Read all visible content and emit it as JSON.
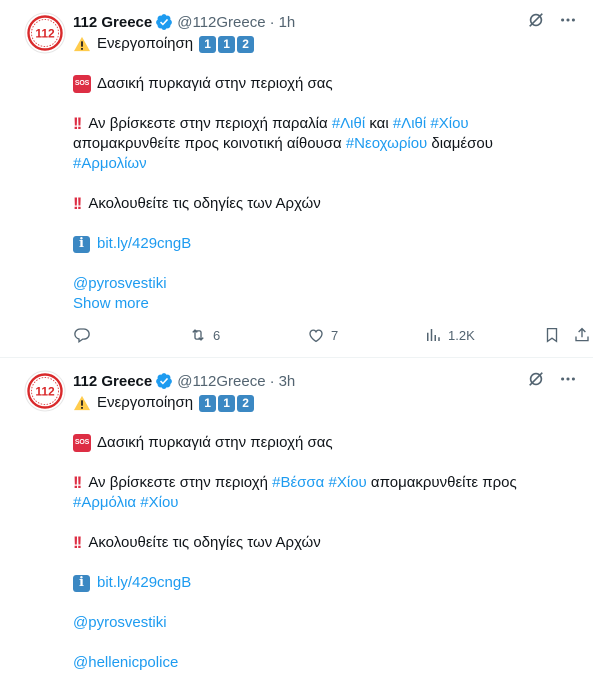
{
  "colors": {
    "link": "#1d9bf0",
    "text": "#0f1419",
    "secondary": "#536471",
    "verified": "#1d9bf0",
    "brand_red": "#d9292b",
    "keycap_blue": "#3b88c3",
    "sos_red": "#dd2e44"
  },
  "tweets": [
    {
      "author": {
        "name": "112 Greece",
        "handle": "@112Greece",
        "avatar_icon": "112-logo-icon",
        "verified_icon": "verified-badge-icon"
      },
      "dot": "·",
      "time": "1h",
      "activation": {
        "warning_icon": "warning-icon",
        "text": "Ενεργοποίηση",
        "keycaps": [
          "1",
          "1",
          "2"
        ]
      },
      "sos_icon_label": "SOS",
      "sos_text": "Δασική πυρκαγιά στην περιοχή σας",
      "evac_line1": {
        "prefix": "Αν βρίσκεστε στην περιοχή παραλία ",
        "tag1": "#Λιθί",
        "mid": " και ",
        "tag2": "#Λιθί",
        "sp": " ",
        "tag3": "#Χίου"
      },
      "evac_line2": {
        "prefix": "απομακρυνθείτε προς κοινοτική αίθουσα ",
        "tag": "#Νεοχωρίου",
        "suffix": " διαμέσου"
      },
      "evac_line3": {
        "tag": "#Αρμολίων"
      },
      "follow_text": "Ακολουθείτε τις οδηγίες των Αρχών",
      "info_icon_label": "i",
      "link": "bit.ly/429cngB",
      "mention": "@pyrosvestiki",
      "show_more": "Show more",
      "actions": {
        "replies": "",
        "reposts": "6",
        "likes": "7",
        "views": "1.2K"
      }
    },
    {
      "author": {
        "name": "112 Greece",
        "handle": "@112Greece",
        "avatar_icon": "112-logo-icon",
        "verified_icon": "verified-badge-icon"
      },
      "dot": "·",
      "time": "3h",
      "activation": {
        "warning_icon": "warning-icon",
        "text": "Ενεργοποίηση",
        "keycaps": [
          "1",
          "1",
          "2"
        ]
      },
      "sos_icon_label": "SOS",
      "sos_text": "Δασική πυρκαγιά στην περιοχή σας",
      "evac_line1": {
        "prefix": "Αν βρίσκεστε στην περιοχή ",
        "tag1": "#Βέσσα",
        "sp": " ",
        "tag2": "#Χίου",
        "suffix": " απομακρυνθείτε προς"
      },
      "evac_line2": {
        "tag1": "#Αρμόλια",
        "sp": " ",
        "tag2": "#Χίου"
      },
      "follow_text": "Ακολουθείτε τις οδηγίες των Αρχών",
      "info_icon_label": "i",
      "link": "bit.ly/429cngB",
      "mention1": "@pyrosvestiki",
      "mention2": "@hellenicpolice"
    }
  ]
}
